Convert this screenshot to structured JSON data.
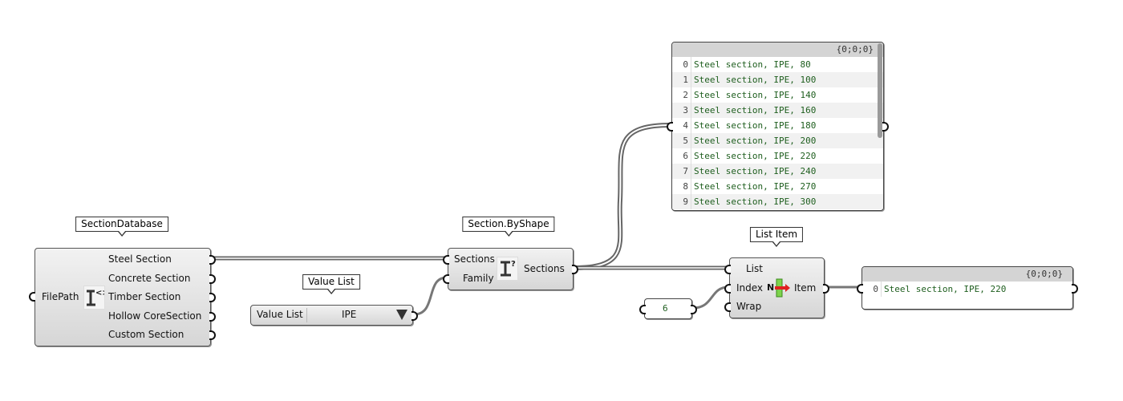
{
  "section_database": {
    "tag": "SectionDatabase",
    "input": "FilePath",
    "outputs": [
      "Steel Section",
      "Concrete Section",
      "Timber Section",
      "Hollow CoreSection",
      "Custom Section"
    ]
  },
  "value_list": {
    "tag": "Value List",
    "label": "Value List",
    "selected": "IPE"
  },
  "section_by_shape": {
    "tag": "Section.ByShape",
    "inputs": [
      "Sections",
      "Family"
    ],
    "output": "Sections"
  },
  "panel_sections": {
    "path": "{0;0;0}",
    "rows": [
      {
        "i": "0",
        "v": "Steel section, IPE, 80"
      },
      {
        "i": "1",
        "v": "Steel section, IPE, 100"
      },
      {
        "i": "2",
        "v": "Steel section, IPE, 140"
      },
      {
        "i": "3",
        "v": "Steel section, IPE, 160"
      },
      {
        "i": "4",
        "v": "Steel section, IPE, 180"
      },
      {
        "i": "5",
        "v": "Steel section, IPE, 200"
      },
      {
        "i": "6",
        "v": "Steel section, IPE, 220"
      },
      {
        "i": "7",
        "v": "Steel section, IPE, 240"
      },
      {
        "i": "8",
        "v": "Steel section, IPE, 270"
      },
      {
        "i": "9",
        "v": "Steel section, IPE, 300"
      }
    ]
  },
  "number_panel": {
    "value": "6"
  },
  "list_item": {
    "tag": "List Item",
    "inputs": [
      "List",
      "Index",
      "Wrap"
    ],
    "output": "Item",
    "icon_letter": "N"
  },
  "panel_result": {
    "path": "{0;0;0}",
    "rows": [
      {
        "i": "0",
        "v": "Steel section, IPE, 220"
      }
    ]
  }
}
